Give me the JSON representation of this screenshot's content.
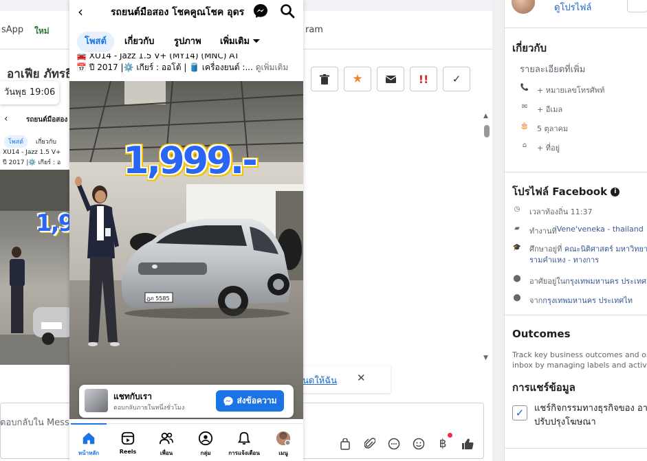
{
  "background": {
    "tab_left_text": "sApp",
    "tab_new_badge": "ใหม่",
    "tab_right_text": "ram",
    "contact_name": "อาเฟีย ภัทรธิ",
    "date_chip": "วันพุธ 19:06",
    "mini_preview": {
      "page_title": "รถยนต์มือสอง",
      "tab_posts": "โพสต์",
      "tab_about": "เกี่ยวกับ",
      "line1": "XU14 - Jazz 1.5 V+",
      "line2": "ปี 2017 |⚙️ เกียร์ : อ",
      "price_fragment": "1,9"
    },
    "notice_link": "นดให้ฉัน",
    "reply_placeholder": "ตอบกลับใน Mess",
    "action_icons": [
      "trash-icon",
      "star-icon",
      "envelope-icon",
      "alert-icon",
      "check-icon"
    ],
    "composer_icons": [
      "bag-icon",
      "paperclip-icon",
      "chat-bubble-icon",
      "smiley-icon",
      "baht-icon",
      "thumbs-up-icon"
    ],
    "colors": {
      "star": "#e8872b",
      "alert": "#d62b2b",
      "link": "#1a66c7"
    }
  },
  "sidebar": {
    "profile_link": "ดูโปรไฟล์",
    "about": {
      "heading": "เกี่ยวกับ",
      "details_label": "รายละเอียดที่เพิ่ม",
      "rows": [
        {
          "icon": "phone-icon",
          "text": "+ หมายเลขโทรศัพท์"
        },
        {
          "icon": "mail-icon",
          "text": "+ อีเมล"
        },
        {
          "icon": "cake-icon",
          "text": "5 ตุลาคม"
        },
        {
          "icon": "home-icon",
          "text": "+ ที่อยู่"
        }
      ]
    },
    "facebook_profile": {
      "heading": "โปรไฟล์ Facebook",
      "rows": [
        {
          "icon": "clock-icon",
          "prefix": "เวลาท้องถิ่น 11:37",
          "link": ""
        },
        {
          "icon": "briefcase-icon",
          "prefix": "ทำงานที่ ",
          "link": "Vene'veneka - thailand"
        },
        {
          "icon": "graduation-icon",
          "prefix": "ศึกษาอยู่ที่ ",
          "link": "คณะนิติศาสตร์ มหาวิทยา",
          "line2": "รามคำแหง - ทางการ"
        },
        {
          "icon": "location-icon",
          "prefix": "อาศัยอยู่ใน ",
          "link": "กรุงเทพมหานคร ประเทศ"
        },
        {
          "icon": "location-icon",
          "prefix": "จาก ",
          "link": "กรุงเทพมหานคร ประเทศไท"
        }
      ]
    },
    "outcomes": {
      "heading": "Outcomes",
      "desc_line1": "Track key business outcomes and org",
      "desc_line2": "inbox by managing labels and activiti"
    },
    "data_sharing": {
      "heading": "การแชร์ข้อมูล",
      "checkbox_line1": "แชร์กิจกรรมทางธุรกิจของ อา",
      "checkbox_line2": "ปรับปรุงโฆษณา",
      "checked": true
    }
  },
  "phone": {
    "page_title": "รถยนต์มือสอง โชคคูณโชค อุดร",
    "tabs": [
      {
        "label": "โพสต์",
        "active": true
      },
      {
        "label": "เกี่ยวกับ",
        "active": false
      },
      {
        "label": "รูปภาพ",
        "active": false
      },
      {
        "label": "เพิ่มเติม ⏷",
        "active": false
      }
    ],
    "post_line1": "🚘 XU14 - Jazz 1.5 V+ (MY14) (MNC) AT",
    "post_line2": "📅 ปี 2017 |⚙️ เกียร์ : ออโต้ | 🛢️ เครื่องยนต์ :...",
    "see_more": "ดูเพิ่มเติม",
    "price": "1,999.-",
    "plate": "ฎภ 5585",
    "chat_card": {
      "title": "แชทกับเรา",
      "subtitle": "ตอบกลับภายในหนึ่งชั่วโมง",
      "button": "ส่งข้อความ"
    },
    "nav": [
      {
        "label": "หน้าหลัก",
        "icon": "home-icon",
        "active": true
      },
      {
        "label": "Reels",
        "icon": "reels-icon",
        "active": false
      },
      {
        "label": "เพื่อน",
        "icon": "friends-icon",
        "active": false
      },
      {
        "label": "กลุ่ม",
        "icon": "groups-icon",
        "active": false
      },
      {
        "label": "การแจ้งเตือน",
        "icon": "bell-icon",
        "active": false
      },
      {
        "label": "เมนู",
        "icon": "menu-avatar-icon",
        "active": false
      }
    ],
    "colors": {
      "accent": "#1b74e4",
      "price_fill": "#2a66f1",
      "price_outline": "#f3c300"
    }
  }
}
